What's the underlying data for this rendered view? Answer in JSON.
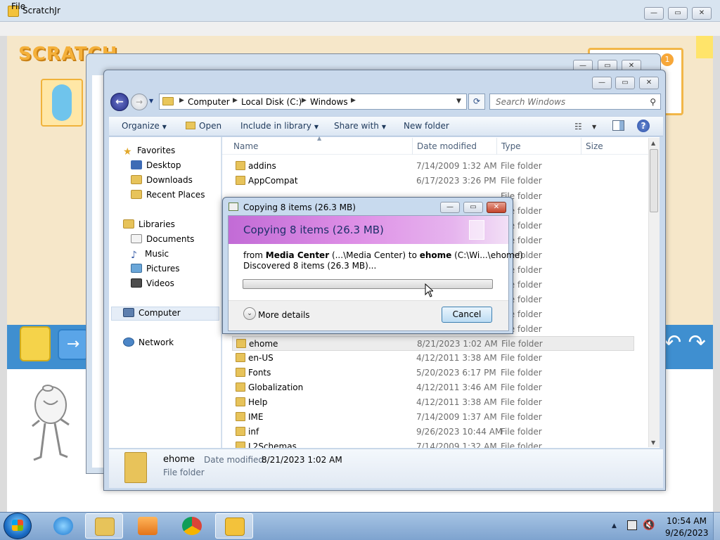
{
  "scratch": {
    "title": "ScratchJr",
    "menu_file": "File",
    "logo_text": "SCRATCH",
    "badge": "1",
    "arrow_glyph": "→",
    "undo_glyph": "↶ ↷",
    "icons": [
      "scratch-logo",
      "character-thumbnail",
      "cat-sprite",
      "undo-icon",
      "redo-icon"
    ]
  },
  "window_controls": {
    "minimize": "—",
    "maximize": "▭",
    "close": "✕"
  },
  "explorer": {
    "breadcrumbs": [
      "Computer",
      "Local Disk (C:)",
      "Windows"
    ],
    "search_placeholder": "Search Windows",
    "toolbar": {
      "organize": "Organize",
      "open": "Open",
      "include_in_library": "Include in library",
      "share_with": "Share with",
      "new_folder": "New folder"
    },
    "nav": {
      "favorites": "Favorites",
      "desktop": "Desktop",
      "downloads": "Downloads",
      "recent_places": "Recent Places",
      "libraries": "Libraries",
      "documents": "Documents",
      "music": "Music",
      "pictures": "Pictures",
      "videos": "Videos",
      "computer": "Computer",
      "network": "Network"
    },
    "columns": {
      "name": "Name",
      "date_modified": "Date modified",
      "type": "Type",
      "size": "Size"
    },
    "files_top": [
      {
        "name": "addins",
        "date": "7/14/2009 1:32 AM",
        "type": "File folder"
      },
      {
        "name": "AppCompat",
        "date": "6/17/2023 3:26 PM",
        "type": "File folder"
      }
    ],
    "obscured_type": "File folder",
    "files_bottom": [
      {
        "name": "ehome",
        "date": "8/21/2023 1:02 AM",
        "type": "File folder"
      },
      {
        "name": "en-US",
        "date": "4/12/2011 3:38 AM",
        "type": "File folder"
      },
      {
        "name": "Fonts",
        "date": "5/20/2023 6:17 PM",
        "type": "File folder"
      },
      {
        "name": "Globalization",
        "date": "4/12/2011 3:46 AM",
        "type": "File folder"
      },
      {
        "name": "Help",
        "date": "4/12/2011 3:38 AM",
        "type": "File folder"
      },
      {
        "name": "IME",
        "date": "7/14/2009 1:37 AM",
        "type": "File folder"
      },
      {
        "name": "inf",
        "date": "9/26/2023 10:44 AM",
        "type": "File folder"
      },
      {
        "name": "L2Schemas",
        "date": "7/14/2009 1:32 AM",
        "type": "File folder"
      }
    ],
    "details": {
      "name": "ehome",
      "date_label": "Date modified:",
      "date_value": "8/21/2023 1:02 AM",
      "type": "File folder"
    }
  },
  "copy_dialog": {
    "title": "Copying 8 items (26.3 MB)",
    "heading": "Copying 8 items (26.3 MB)",
    "from_label": "from",
    "from_source": "Media Center",
    "from_source_path": "(...\\Media Center)",
    "to_label": "to",
    "to_dest": "ehome",
    "to_dest_path": "(C:\\Wi...\\ehome)",
    "discovered": "Discovered 8 items (26.3 MB)...",
    "progress_fraction": 0,
    "more_details": "More details",
    "cancel": "Cancel"
  },
  "taskbar": {
    "apps": [
      "internet-explorer-icon",
      "windows-explorer-icon",
      "media-player-icon",
      "chrome-icon",
      "scratchjr-icon"
    ],
    "clock_time": "10:54 AM",
    "clock_date": "9/26/2023"
  },
  "colors": {
    "accent": "#3f8fd0",
    "banner": "#c26bd6",
    "taskbar": "#7ea3cf"
  }
}
